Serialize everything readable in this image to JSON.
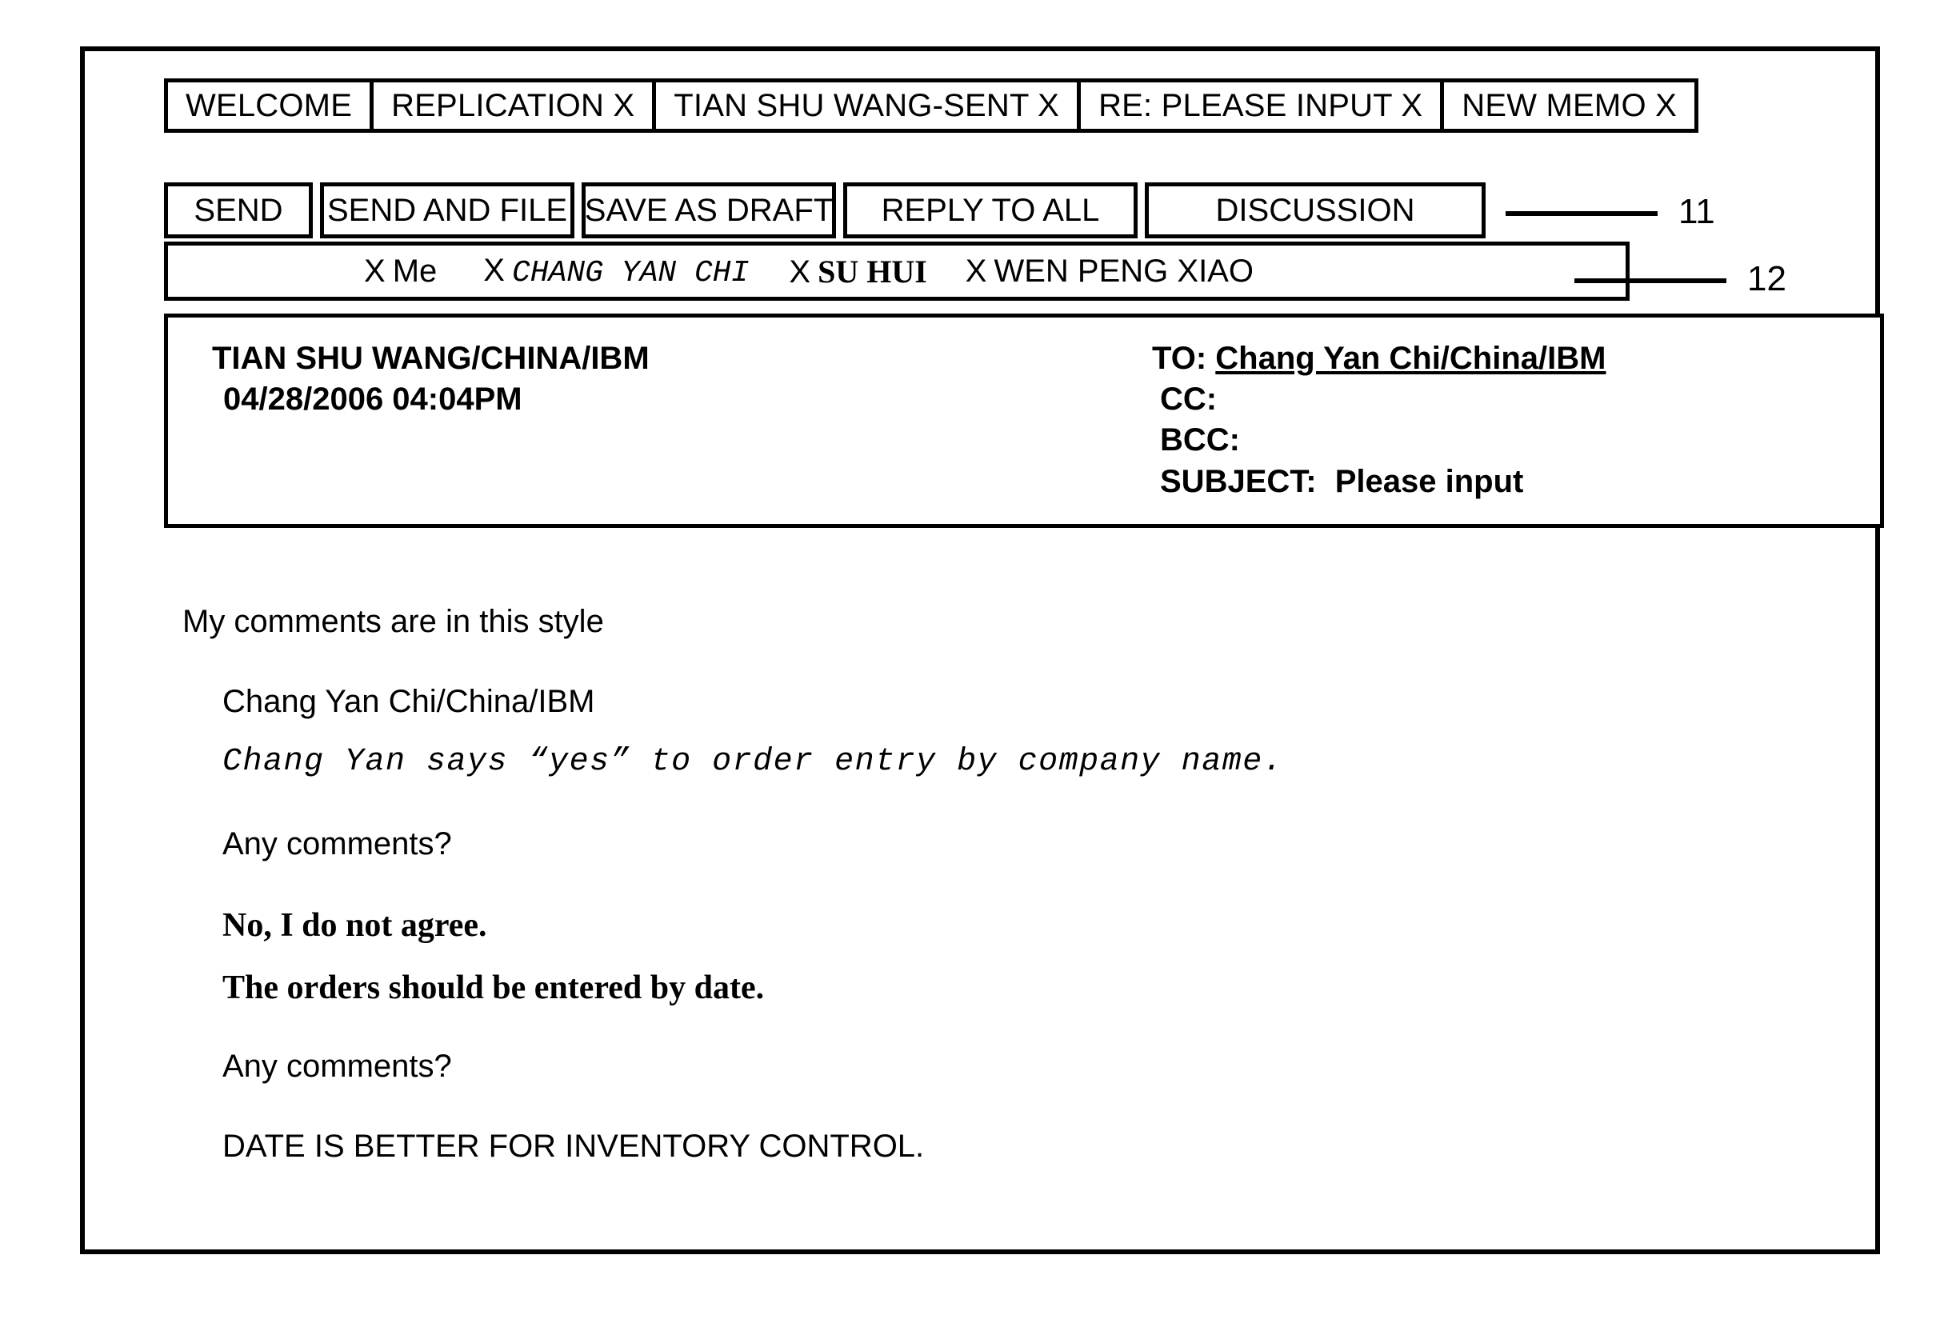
{
  "tabs": [
    {
      "label": "WELCOME"
    },
    {
      "label": "REPLICATION X"
    },
    {
      "label": "TIAN SHU WANG-SENT X"
    },
    {
      "label": "RE: PLEASE INPUT X"
    },
    {
      "label": "NEW MEMO X"
    }
  ],
  "toolbar": {
    "send_label": "SEND",
    "send_and_file_label": "SEND AND FILE",
    "save_as_draft_label": "SAVE AS DRAFT",
    "reply_to_all_label": "REPLY TO ALL",
    "discussion_label": "DISCUSSION"
  },
  "participants": {
    "x_mark": "X",
    "items": [
      {
        "name": "Me",
        "style": "sans"
      },
      {
        "name": "CHANG YAN CHI",
        "style": "mono-italic"
      },
      {
        "name": "SU HUI",
        "style": "serif-bold"
      },
      {
        "name": "WEN PENG XIAO",
        "style": "sans"
      }
    ]
  },
  "message_header": {
    "sender": "TIAN SHU WANG/CHINA/IBM",
    "timestamp": "04/28/2006 04:04PM",
    "to_label": "TO:",
    "to_value": "Chang Yan Chi/China/IBM",
    "cc_label": "CC:",
    "cc_value": "",
    "bcc_label": "BCC:",
    "bcc_value": "",
    "subject_label": "SUBJECT:",
    "subject_value": "Please input"
  },
  "body": {
    "lines": [
      {
        "text": "My comments are in this style",
        "style": "sans"
      },
      {
        "text": "Chang Yan Chi/China/IBM",
        "style": "sans"
      },
      {
        "text": "Chang Yan says “yes” to order entry by company name.",
        "style": "mono-italic"
      },
      {
        "text": "Any comments?",
        "style": "sans"
      },
      {
        "text": "No, I do not agree.",
        "style": "serif-bold"
      },
      {
        "text": "The orders should be entered by date.",
        "style": "serif-bold"
      },
      {
        "text": "Any comments?",
        "style": "sans"
      },
      {
        "text": "DATE IS BETTER FOR INVENTORY CONTROL.",
        "style": "sans"
      }
    ]
  },
  "reference_numerals": [
    {
      "label": "11"
    },
    {
      "label": "12"
    }
  ]
}
